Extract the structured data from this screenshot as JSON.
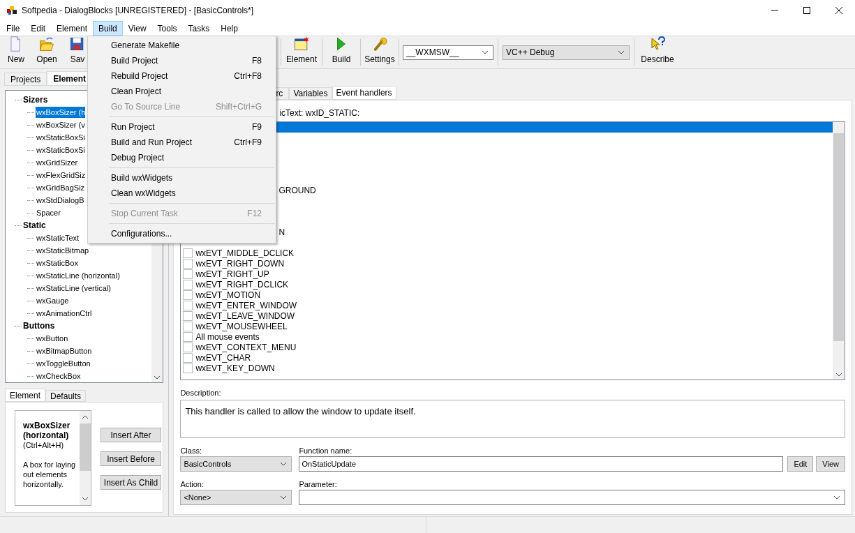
{
  "window": {
    "title": "Softpedia - DialogBlocks [UNREGISTERED] - [BasicControls*]"
  },
  "menu_bar": [
    {
      "label": "File",
      "selected": false
    },
    {
      "label": "Edit",
      "selected": false
    },
    {
      "label": "Element",
      "selected": false
    },
    {
      "label": "Build",
      "selected": true
    },
    {
      "label": "View",
      "selected": false
    },
    {
      "label": "Tools",
      "selected": false
    },
    {
      "label": "Tasks",
      "selected": false
    },
    {
      "label": "Help",
      "selected": false
    }
  ],
  "build_menu": [
    {
      "kind": "item",
      "label": "Generate Makefile",
      "disabled": false
    },
    {
      "kind": "item",
      "label": "Build Project",
      "shortcut": "F8",
      "disabled": false
    },
    {
      "kind": "item",
      "label": "Rebuild Project",
      "shortcut": "Ctrl+F8",
      "disabled": false
    },
    {
      "kind": "item",
      "label": "Clean Project",
      "disabled": false
    },
    {
      "kind": "item",
      "label": "Go To Source Line",
      "shortcut": "Shift+Ctrl+G",
      "disabled": true
    },
    {
      "kind": "separator"
    },
    {
      "kind": "item",
      "label": "Run Project",
      "shortcut": "F9",
      "disabled": false
    },
    {
      "kind": "item",
      "label": "Build and Run Project",
      "shortcut": "Ctrl+F9",
      "disabled": false
    },
    {
      "kind": "item",
      "label": "Debug Project",
      "disabled": false
    },
    {
      "kind": "separator"
    },
    {
      "kind": "item",
      "label": "Build wxWidgets",
      "disabled": false
    },
    {
      "kind": "item",
      "label": "Clean wxWidgets",
      "disabled": false
    },
    {
      "kind": "separator"
    },
    {
      "kind": "item",
      "label": "Stop Current Task",
      "shortcut": "F12",
      "disabled": true
    },
    {
      "kind": "separator"
    },
    {
      "kind": "item",
      "label": "Configurations...",
      "disabled": false
    }
  ],
  "toolbar": {
    "left_buttons": [
      "New",
      "Open",
      "Sav"
    ],
    "right_buttons": [
      "Element",
      "Build",
      "Settings"
    ],
    "platform_combo": "__WXMSW__",
    "config_combo": "VC++ Debug",
    "describe_button": "Describe"
  },
  "left_tabs": [
    {
      "label": "Projects",
      "selected": false
    },
    {
      "label": "Element",
      "selected": true
    }
  ],
  "tree": [
    {
      "label": "Sizers",
      "children": [
        {
          "label": "wxBoxSizer (h",
          "selected": true
        },
        {
          "label": "wxBoxSizer (v",
          "selected": false
        },
        {
          "label": "wxStaticBoxSi",
          "selected": false
        },
        {
          "label": "wxStaticBoxSi",
          "selected": false
        },
        {
          "label": "wxGridSizer",
          "selected": false
        },
        {
          "label": "wxFlexGridSiz",
          "selected": false
        },
        {
          "label": "wxGridBagSiz",
          "selected": false
        },
        {
          "label": "wxStdDialogB",
          "selected": false
        },
        {
          "label": "Spacer",
          "selected": false
        }
      ]
    },
    {
      "label": "Static",
      "children": [
        {
          "label": "wxStaticText",
          "selected": false
        },
        {
          "label": "wxStaticBitmap",
          "selected": false
        },
        {
          "label": "wxStaticBox",
          "selected": false
        },
        {
          "label": "wxStaticLine (horizontal)",
          "selected": false
        },
        {
          "label": "wxStaticLine (vertical)",
          "selected": false
        },
        {
          "label": "wxGauge",
          "selected": false
        },
        {
          "label": "wxAnimationCtrl",
          "selected": false
        }
      ]
    },
    {
      "label": "Buttons",
      "children": [
        {
          "label": "wxButton",
          "selected": false
        },
        {
          "label": "wxBitmapButton",
          "selected": false
        },
        {
          "label": "wxToggleButton",
          "selected": false
        },
        {
          "label": "wxCheckBox",
          "selected": false
        }
      ]
    }
  ],
  "bottom_tabs": [
    {
      "label": "Element",
      "selected": true
    },
    {
      "label": "Defaults",
      "selected": false
    }
  ],
  "element_info": {
    "title": "wxBoxSizer (horizontal)",
    "shortcut": "(Ctrl+Alt+H)",
    "description": "A box for laying out elements horizontally."
  },
  "insert_buttons": [
    "Insert After",
    "Insert Before",
    "Insert As Child"
  ],
  "right_tabs": [
    {
      "label": "rc",
      "selected": false
    },
    {
      "label": "Variables",
      "selected": false
    },
    {
      "label": "Event handlers",
      "selected": true
    }
  ],
  "list_label": "icText: wxID_STATIC:",
  "events": [
    {
      "selected": true
    },
    {
      "selected": false
    },
    {
      "selected": false
    },
    {
      "selected": false
    },
    {
      "selected": false
    },
    {
      "selected": false
    },
    {
      "kind": "cut",
      "label": "GROUND",
      "selected": false
    },
    {
      "selected": false
    },
    {
      "selected": false
    },
    {
      "selected": false
    },
    {
      "kind": "cut",
      "label": "N",
      "selected": false
    },
    {
      "selected": false
    },
    {
      "kind": "event",
      "label": "wxEVT_MIDDLE_DCLICK",
      "checked": false,
      "selected": false
    },
    {
      "kind": "event",
      "label": "wxEVT_RIGHT_DOWN",
      "checked": false,
      "selected": false
    },
    {
      "kind": "event",
      "label": "wxEVT_RIGHT_UP",
      "checked": false,
      "selected": false
    },
    {
      "kind": "event",
      "label": "wxEVT_RIGHT_DCLICK",
      "checked": false,
      "selected": false
    },
    {
      "kind": "event",
      "label": "wxEVT_MOTION",
      "checked": false,
      "selected": false
    },
    {
      "kind": "event",
      "label": "wxEVT_ENTER_WINDOW",
      "checked": false,
      "selected": false
    },
    {
      "kind": "event",
      "label": "wxEVT_LEAVE_WINDOW",
      "checked": false,
      "selected": false
    },
    {
      "kind": "event",
      "label": "wxEVT_MOUSEWHEEL",
      "checked": false,
      "selected": false
    },
    {
      "kind": "event",
      "label": "All mouse events",
      "checked": false,
      "selected": false
    },
    {
      "kind": "event",
      "label": "wxEVT_CONTEXT_MENU",
      "checked": false,
      "selected": false
    },
    {
      "kind": "event",
      "label": "wxEVT_CHAR",
      "checked": false,
      "selected": false
    },
    {
      "kind": "event",
      "label": "wxEVT_KEY_DOWN",
      "checked": false,
      "selected": false
    }
  ],
  "description": {
    "label": "Description:",
    "text": "This handler is called to allow the window to update itself."
  },
  "class": {
    "label": "Class:",
    "value": "BasicControls"
  },
  "function_name": {
    "label": "Function name:",
    "value": "OnStaticUpdate"
  },
  "function_buttons": [
    "Edit",
    "View"
  ],
  "action": {
    "label": "Action:",
    "value": "<None>"
  },
  "parameter": {
    "label": "Parameter:"
  }
}
